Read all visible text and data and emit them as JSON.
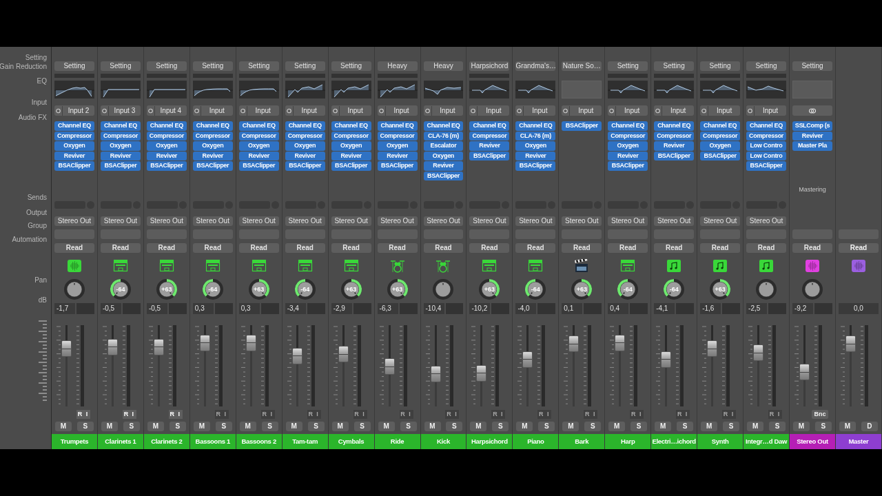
{
  "row_labels": [
    "Setting",
    "Gain Reduction",
    "EQ",
    "Input",
    "Audio FX",
    "Sends",
    "Output",
    "Group",
    "Automation",
    "Pan",
    "dB"
  ],
  "strips": [
    {
      "name": "Trumpets",
      "color": "#2bb52b",
      "setting": "Setting",
      "gain_reduction": true,
      "eq": {
        "kind": "hump"
      },
      "input": {
        "kind": "mono",
        "label": "Input 2"
      },
      "fx": [
        "Channel EQ",
        "Compressor",
        "Oxygen",
        "Reviver",
        "BSAClipper"
      ],
      "output": "Stereo Out",
      "automation": {
        "label": "Read",
        "on": true
      },
      "icon": {
        "kind": "waveform",
        "color": "#39d839"
      },
      "pan": {
        "kind": "center"
      },
      "db": {
        "value": "-1,7",
        "peak_box": true
      },
      "fader": {
        "level": 0.71
      },
      "rec": {
        "labels": [
          "R",
          "I"
        ],
        "enabled": true
      },
      "buttons": [
        "M",
        "S"
      ]
    },
    {
      "name": "Clarinets 1",
      "color": "#2bb52b",
      "setting": "Setting",
      "gain_reduction": true,
      "eq": {
        "kind": "lowcut_flat"
      },
      "input": {
        "kind": "mono",
        "label": "Input 3"
      },
      "fx": [
        "Channel EQ",
        "Compressor",
        "Oxygen",
        "Reviver",
        "BSAClipper"
      ],
      "output": "Stereo Out",
      "automation": {
        "label": "Read",
        "on": true
      },
      "icon": {
        "kind": "keyboard",
        "color": "#39d839"
      },
      "pan": {
        "kind": "left",
        "label": "-64"
      },
      "db": {
        "value": "-0,5",
        "peak_box": true
      },
      "fader": {
        "level": 0.73
      },
      "rec": {
        "labels": [
          "R",
          "I"
        ],
        "enabled": true
      },
      "buttons": [
        "M",
        "S"
      ]
    },
    {
      "name": "Clarinets 2",
      "color": "#2bb52b",
      "setting": "Setting",
      "gain_reduction": true,
      "eq": {
        "kind": "lowcut_flat"
      },
      "input": {
        "kind": "mono",
        "label": "Input 4"
      },
      "fx": [
        "Channel EQ",
        "Compressor",
        "Oxygen",
        "Reviver",
        "BSAClipper"
      ],
      "output": "Stereo Out",
      "automation": {
        "label": "Read",
        "on": true
      },
      "icon": {
        "kind": "keyboard",
        "color": "#39d839"
      },
      "pan": {
        "kind": "right",
        "label": "+63"
      },
      "db": {
        "value": "-0,5",
        "peak_box": true
      },
      "fader": {
        "level": 0.73
      },
      "rec": {
        "labels": [
          "R",
          "I"
        ],
        "enabled": true
      },
      "buttons": [
        "M",
        "S"
      ]
    },
    {
      "name": "Bassoons 1",
      "color": "#2bb52b",
      "setting": "Setting",
      "gain_reduction": true,
      "eq": {
        "kind": "lowcut_wavy"
      },
      "input": {
        "kind": "mono",
        "label": "Input"
      },
      "fx": [
        "Channel EQ",
        "Compressor",
        "Oxygen",
        "Reviver",
        "BSAClipper"
      ],
      "output": "Stereo Out",
      "automation": {
        "label": "Read",
        "on": true
      },
      "icon": {
        "kind": "keyboard",
        "color": "#39d839"
      },
      "pan": {
        "kind": "left",
        "label": "-64"
      },
      "db": {
        "value": "0,3",
        "peak_box": true
      },
      "fader": {
        "level": 0.78
      },
      "rec": {
        "labels": [
          "R",
          "I"
        ],
        "enabled": false
      },
      "buttons": [
        "M",
        "S"
      ]
    },
    {
      "name": "Bassoons 2",
      "color": "#2bb52b",
      "setting": "Setting",
      "gain_reduction": true,
      "eq": {
        "kind": "lowcut_wavy"
      },
      "input": {
        "kind": "mono",
        "label": "Input"
      },
      "fx": [
        "Channel EQ",
        "Compressor",
        "Oxygen",
        "Reviver",
        "BSAClipper"
      ],
      "output": "Stereo Out",
      "automation": {
        "label": "Read",
        "on": true
      },
      "icon": {
        "kind": "keyboard",
        "color": "#39d839"
      },
      "pan": {
        "kind": "right",
        "label": "+63"
      },
      "db": {
        "value": "0,3",
        "peak_box": true
      },
      "fader": {
        "level": 0.78
      },
      "rec": {
        "labels": [
          "R",
          "I"
        ],
        "enabled": false
      },
      "buttons": [
        "M",
        "S"
      ]
    },
    {
      "name": "Tam-tam",
      "color": "#2bb52b",
      "setting": "Setting",
      "gain_reduction": true,
      "eq": {
        "kind": "lowcut_rise"
      },
      "input": {
        "kind": "mono",
        "label": "Input"
      },
      "fx": [
        "Channel EQ",
        "Compressor",
        "Oxygen",
        "Reviver",
        "BSAClipper"
      ],
      "output": "Stereo Out",
      "automation": {
        "label": "Read",
        "on": true
      },
      "icon": {
        "kind": "keyboard",
        "color": "#39d839"
      },
      "pan": {
        "kind": "left",
        "label": "-64"
      },
      "db": {
        "value": "-3,4",
        "peak_box": true
      },
      "fader": {
        "level": 0.62
      },
      "rec": {
        "labels": [
          "R",
          "I"
        ],
        "enabled": false
      },
      "buttons": [
        "M",
        "S"
      ]
    },
    {
      "name": "Cymbals",
      "color": "#2bb52b",
      "setting": "Setting",
      "gain_reduction": true,
      "eq": {
        "kind": "lowcut_rise"
      },
      "input": {
        "kind": "mono",
        "label": "Input"
      },
      "fx": [
        "Channel EQ",
        "Compressor",
        "Oxygen",
        "Reviver",
        "BSAClipper"
      ],
      "output": "Stereo Out",
      "automation": {
        "label": "Read",
        "on": true
      },
      "icon": {
        "kind": "keyboard",
        "color": "#39d839"
      },
      "pan": {
        "kind": "right",
        "label": "+63"
      },
      "db": {
        "value": "-2,9",
        "peak_box": true
      },
      "fader": {
        "level": 0.64
      },
      "rec": {
        "labels": [
          "R",
          "I"
        ],
        "enabled": false
      },
      "buttons": [
        "M",
        "S"
      ]
    },
    {
      "name": "Ride",
      "color": "#2bb52b",
      "setting": "Heavy",
      "gain_reduction": true,
      "eq": {
        "kind": "lowcut_rise"
      },
      "input": {
        "kind": "mono",
        "label": "Input"
      },
      "fx": [
        "Channel EQ",
        "Compressor",
        "Oxygen",
        "Reviver",
        "BSAClipper"
      ],
      "output": "Stereo Out",
      "automation": {
        "label": "Read",
        "on": true
      },
      "icon": {
        "kind": "drums",
        "color": "#39d839"
      },
      "pan": {
        "kind": "right",
        "label": "+63"
      },
      "db": {
        "value": "-6,3",
        "peak_box": true
      },
      "fader": {
        "level": 0.49
      },
      "rec": {
        "labels": [
          "R",
          "I"
        ],
        "enabled": false
      },
      "buttons": [
        "M",
        "S"
      ]
    },
    {
      "name": "Kick",
      "color": "#2bb52b",
      "setting": "Heavy",
      "gain_reduction": false,
      "eq": {
        "kind": "dip_shelf"
      },
      "input": {
        "kind": "mono",
        "label": "Input"
      },
      "fx": [
        "Channel EQ",
        "CLA-76 (m)",
        "Escalator",
        "Oxygen",
        "Reviver",
        "BSAClipper"
      ],
      "output": "Stereo Out",
      "automation": {
        "label": "Read",
        "on": true
      },
      "icon": {
        "kind": "drums",
        "color": "#39d839"
      },
      "pan": {
        "kind": "center"
      },
      "db": {
        "value": "-10,4",
        "peak_box": true
      },
      "fader": {
        "level": 0.4
      },
      "rec": {
        "labels": [
          "R",
          "I"
        ],
        "enabled": false
      },
      "buttons": [
        "M",
        "S"
      ]
    },
    {
      "name": "Harpsichord",
      "color": "#2bb52b",
      "setting": "Harpsichord",
      "gain_reduction": true,
      "eq": {
        "kind": "notch_peak"
      },
      "input": {
        "kind": "mono",
        "label": "Input"
      },
      "fx": [
        "Channel EQ",
        "Compressor",
        "Reviver",
        "BSAClipper"
      ],
      "output": "Stereo Out",
      "automation": {
        "label": "Read",
        "on": true
      },
      "icon": {
        "kind": "keyboard",
        "color": "#39d839"
      },
      "pan": {
        "kind": "right",
        "label": "+63"
      },
      "db": {
        "value": "-10,2",
        "peak_box": true
      },
      "fader": {
        "level": 0.41
      },
      "rec": {
        "labels": [
          "R",
          "I"
        ],
        "enabled": false
      },
      "buttons": [
        "M",
        "S"
      ]
    },
    {
      "name": "Piano",
      "color": "#2bb52b",
      "setting": "Grandma's…",
      "gain_reduction": false,
      "eq": {
        "kind": "notch_peak"
      },
      "input": {
        "kind": "mono",
        "label": "Input"
      },
      "fx": [
        "Channel EQ",
        "CLA-76 (m)",
        "Oxygen",
        "Reviver",
        "BSAClipper"
      ],
      "output": "Stereo Out",
      "automation": {
        "label": "Read",
        "on": true
      },
      "icon": {
        "kind": "keyboard",
        "color": "#39d839"
      },
      "pan": {
        "kind": "left",
        "label": "-64"
      },
      "db": {
        "value": "-4,0",
        "peak_box": true
      },
      "fader": {
        "level": 0.58
      },
      "rec": {
        "labels": [
          "R",
          "I"
        ],
        "enabled": false
      },
      "buttons": [
        "M",
        "S"
      ]
    },
    {
      "name": "Bark",
      "color": "#2bb52b",
      "setting": "Nature So…",
      "gain_reduction": false,
      "eq": {
        "kind": "empty"
      },
      "input": {
        "kind": "mono",
        "label": "Input"
      },
      "fx": [
        "BSAClipper"
      ],
      "output": "Stereo Out",
      "automation": {
        "label": "Read",
        "on": true
      },
      "icon": {
        "kind": "clapper",
        "color": "#1c2a3a"
      },
      "pan": {
        "kind": "right",
        "label": "+63"
      },
      "db": {
        "value": "0,1",
        "peak_box": true
      },
      "fader": {
        "level": 0.77
      },
      "rec": {
        "labels": [
          "R",
          "I"
        ],
        "enabled": false
      },
      "buttons": [
        "M",
        "S"
      ]
    },
    {
      "name": "Harp",
      "color": "#2bb52b",
      "setting": "Setting",
      "gain_reduction": true,
      "eq": {
        "kind": "notch_peak"
      },
      "input": {
        "kind": "mono",
        "label": "Input"
      },
      "fx": [
        "Channel EQ",
        "Compressor",
        "Oxygen",
        "Reviver",
        "BSAClipper"
      ],
      "output": "Stereo Out",
      "automation": {
        "label": "Read",
        "on": true
      },
      "icon": {
        "kind": "keyboard",
        "color": "#39d839"
      },
      "pan": {
        "kind": "left",
        "label": "-64"
      },
      "db": {
        "value": "0,4",
        "peak_box": true
      },
      "fader": {
        "level": 0.78
      },
      "rec": {
        "labels": [
          "R",
          "I"
        ],
        "enabled": false
      },
      "buttons": [
        "M",
        "S"
      ]
    },
    {
      "name": "Electri…ichord",
      "color": "#2bb52b",
      "setting": "Setting",
      "gain_reduction": true,
      "eq": {
        "kind": "notch_peak"
      },
      "input": {
        "kind": "mono",
        "label": "Input"
      },
      "fx": [
        "Channel EQ",
        "Compressor",
        "Reviver",
        "BSAClipper"
      ],
      "output": "Stereo Out",
      "automation": {
        "label": "Read",
        "on": true
      },
      "icon": {
        "kind": "note",
        "color": "#39d839"
      },
      "pan": {
        "kind": "left",
        "label": "-64"
      },
      "db": {
        "value": "-4,1",
        "peak_box": true
      },
      "fader": {
        "level": 0.58
      },
      "rec": {
        "labels": [
          "R",
          "I"
        ],
        "enabled": false
      },
      "buttons": [
        "M",
        "S"
      ]
    },
    {
      "name": "Synth",
      "color": "#2bb52b",
      "setting": "Setting",
      "gain_reduction": true,
      "eq": {
        "kind": "notch_peak"
      },
      "input": {
        "kind": "mono",
        "label": "Input"
      },
      "fx": [
        "Channel EQ",
        "Compressor",
        "Oxygen",
        "BSAClipper"
      ],
      "output": "Stereo Out",
      "automation": {
        "label": "Read",
        "on": true
      },
      "icon": {
        "kind": "note",
        "color": "#39d839"
      },
      "pan": {
        "kind": "right",
        "label": "+63"
      },
      "db": {
        "value": "-1,6",
        "peak_box": true
      },
      "fader": {
        "level": 0.71
      },
      "rec": {
        "labels": [
          "R",
          "I"
        ],
        "enabled": false
      },
      "buttons": [
        "M",
        "S"
      ]
    },
    {
      "name": "Integr…d Daw",
      "color": "#2bb52b",
      "setting": "Setting",
      "gain_reduction": true,
      "eq": {
        "kind": "double_bump"
      },
      "input": {
        "kind": "mono",
        "label": "Input"
      },
      "fx": [
        "Channel EQ",
        "Compressor",
        "Low Contro",
        "Low Contro",
        "BSAClipper"
      ],
      "output": "Stereo Out",
      "automation": {
        "label": "Read",
        "on": true
      },
      "icon": {
        "kind": "note",
        "color": "#39d839"
      },
      "pan": {
        "kind": "center"
      },
      "db": {
        "value": "-2,5",
        "peak_box": true
      },
      "fader": {
        "level": 0.66
      },
      "rec": {
        "labels": [
          "R",
          "I"
        ],
        "enabled": false
      },
      "buttons": [
        "M",
        "S"
      ]
    },
    {
      "name": "Stereo Out",
      "color": "#b51fb5",
      "setting": "Setting",
      "gain_reduction": false,
      "eq": {
        "kind": "empty"
      },
      "input": {
        "kind": "link"
      },
      "fx": [
        "SSLComp (s",
        "Reviver",
        "Master Pla"
      ],
      "fx_footer": "Mastering",
      "automation": {
        "label": "Read",
        "on": true
      },
      "icon": {
        "kind": "waveform",
        "color": "#e040e0"
      },
      "pan": {
        "kind": "center"
      },
      "db": {
        "value": "-9,2",
        "peak_box": true
      },
      "fader": {
        "level": 0.42
      },
      "bounce": "Bnc",
      "buttons": [
        "M",
        "S"
      ]
    },
    {
      "name": "Master",
      "color": "#8e3ed0",
      "automation": {
        "label": "Read",
        "on": false
      },
      "icon": {
        "kind": "waveform",
        "color": "#9b5fe0"
      },
      "db": {
        "value": "0,0",
        "peak_box": false
      },
      "fader": {
        "level": 0.77
      },
      "buttons": [
        "M",
        "D"
      ]
    }
  ]
}
